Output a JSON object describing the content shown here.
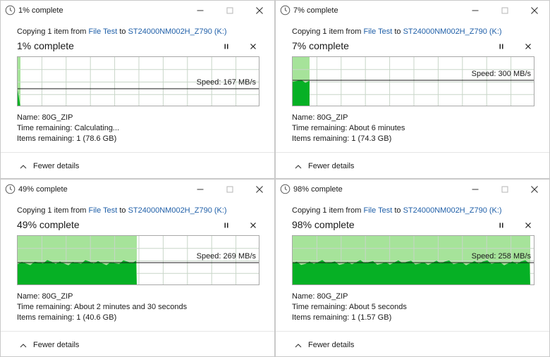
{
  "windows": [
    {
      "title": "1% complete",
      "copy_prefix": "Copying 1 item from",
      "source": "File Test",
      "to_word": "to",
      "dest": "ST24000NM002H_Z790 (K:)",
      "percent_text": "1% complete",
      "progress": 0.01,
      "speed_text": "Speed: 167 MB/s",
      "speed_fraction": 0.36,
      "name_label": "Name:",
      "name_value": "80G_ZIP",
      "time_label": "Time remaining:",
      "time_value": "Calculating...",
      "items_label": "Items remaining:",
      "items_value": "1 (78.6 GB)",
      "fewer_details": "Fewer details"
    },
    {
      "title": "7% complete",
      "copy_prefix": "Copying 1 item from",
      "source": "File Test",
      "to_word": "to",
      "dest": "ST24000NM002H_Z790 (K:)",
      "percent_text": "7% complete",
      "progress": 0.07,
      "speed_text": "Speed: 300 MB/s",
      "speed_fraction": 0.53,
      "name_label": "Name:",
      "name_value": "80G_ZIP",
      "time_label": "Time remaining:",
      "time_value": "About 6 minutes",
      "items_label": "Items remaining:",
      "items_value": "1 (74.3 GB)",
      "fewer_details": "Fewer details"
    },
    {
      "title": "49% complete",
      "copy_prefix": "Copying 1 item from",
      "source": "File Test",
      "to_word": "to",
      "dest": "ST24000NM002H_Z790 (K:)",
      "percent_text": "49% complete",
      "progress": 0.49,
      "speed_text": "Speed: 269 MB/s",
      "speed_fraction": 0.47,
      "name_label": "Name:",
      "name_value": "80G_ZIP",
      "time_label": "Time remaining:",
      "time_value": "About 2 minutes and 30 seconds",
      "items_label": "Items remaining:",
      "items_value": "1 (40.6 GB)",
      "fewer_details": "Fewer details"
    },
    {
      "title": "98% complete",
      "copy_prefix": "Copying 1 item from",
      "source": "File Test",
      "to_word": "to",
      "dest": "ST24000NM002H_Z790 (K:)",
      "percent_text": "98% complete",
      "progress": 0.98,
      "speed_text": "Speed: 258 MB/s",
      "speed_fraction": 0.47,
      "name_label": "Name:",
      "name_value": "80G_ZIP",
      "time_label": "Time remaining:",
      "time_value": "About 5 seconds",
      "items_label": "Items remaining:",
      "items_value": "1 (1.57 GB)",
      "fewer_details": "Fewer details"
    }
  ],
  "icons": {
    "app": "clock-icon",
    "minimize": "minimize-icon",
    "maximize": "maximize-icon",
    "close": "close-icon",
    "pause": "pause-icon",
    "stop": "stop-icon",
    "chevron": "chevron-up-icon"
  },
  "colors": {
    "graph_fill_light": "#a6e39a",
    "graph_fill_dark": "#06b025",
    "grid": "#c8d6c8",
    "speed_line": "#1a1a1a",
    "link": "#1f5fa8"
  }
}
